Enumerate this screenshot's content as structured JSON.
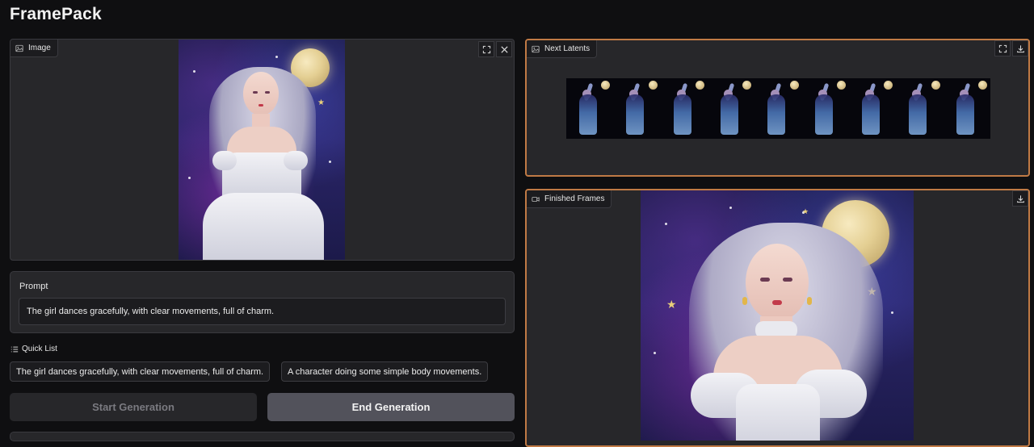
{
  "app": {
    "title": "FramePack"
  },
  "image_panel": {
    "label": "Image",
    "icon": "image-icon",
    "tools": [
      "fullscreen-icon",
      "close-icon"
    ]
  },
  "prompt": {
    "title": "Prompt",
    "value": "The girl dances gracefully, with clear movements, full of charm."
  },
  "quick_list": {
    "label": "Quick List",
    "icon": "list-icon",
    "items": [
      "The girl dances gracefully, with clear movements, full of charm.",
      "A character doing some simple body movements."
    ]
  },
  "buttons": {
    "start": "Start Generation",
    "end": "End Generation"
  },
  "latents_panel": {
    "label": "Next Latents",
    "icon": "image-icon",
    "tools": [
      "fullscreen-icon",
      "download-icon"
    ],
    "frame_count": 9
  },
  "finished_panel": {
    "label": "Finished Frames",
    "icon": "video-icon",
    "tools": [
      "download-icon"
    ]
  },
  "colors": {
    "background": "#0f0f11",
    "panel": "#27272a",
    "accent_border": "#c07a45",
    "button_enabled": "#52525b"
  }
}
